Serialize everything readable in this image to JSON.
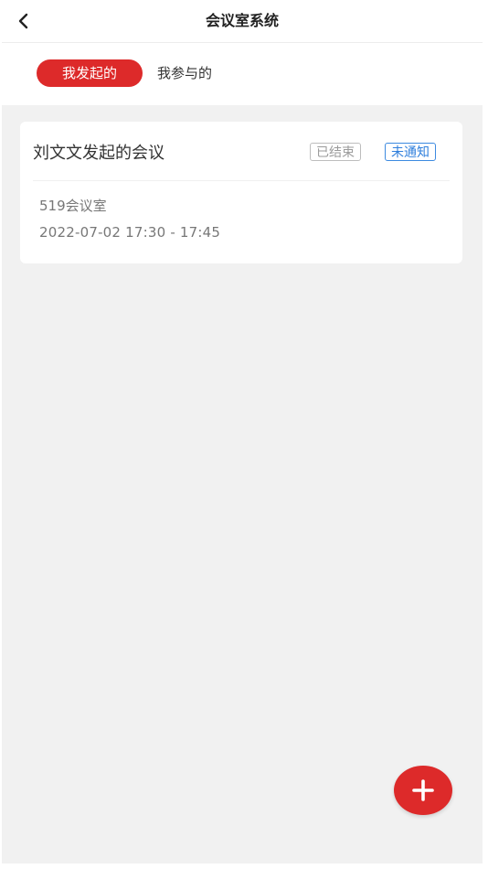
{
  "header": {
    "title": "会议室系统",
    "back_icon": "chevron-left-icon"
  },
  "tabs": [
    {
      "label": "我发起的",
      "active": true
    },
    {
      "label": "我参与的",
      "active": false
    }
  ],
  "meetings": [
    {
      "title": "刘文文发起的会议",
      "status_ended": "已结束",
      "status_notify": "未通知",
      "room": "519会议室",
      "time": "2022-07-02 17:30 - 17:45"
    }
  ],
  "fab": {
    "icon": "plus-icon"
  },
  "colors": {
    "accent": "#dd2a2a",
    "notify_blue": "#2f7fdc",
    "background": "#f1f1f1",
    "muted_text": "#777777"
  }
}
